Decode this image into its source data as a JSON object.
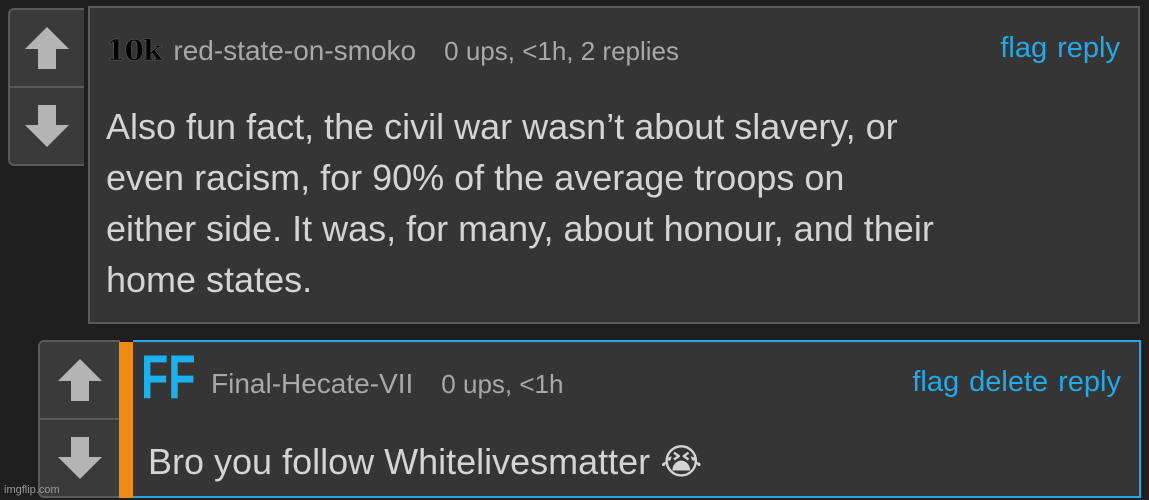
{
  "comment1": {
    "badge": "10k",
    "username": "red-state-on-smoko",
    "stats": "0 ups, <1h, 2 replies",
    "actions": [
      "flag",
      "reply"
    ],
    "body_lines": [
      "Also fun fact, the civil war wasn’t about slavery, or",
      "even racism, for 90% of the average troops on",
      "either side. It was, for many, about honour, and their",
      "home states."
    ]
  },
  "comment2": {
    "badge": "FF",
    "username": "Final-Hecate-VII",
    "stats": "0 ups, <1h",
    "actions": [
      "flag",
      "delete",
      "reply"
    ],
    "body": "Bro you follow Whitelivesmatter",
    "emoji": "😭"
  },
  "watermark": "imgflip.com",
  "colors": {
    "link": "#23a8e8",
    "accent_bar": "#f08b12",
    "highlight_border": "#23a8e8"
  }
}
